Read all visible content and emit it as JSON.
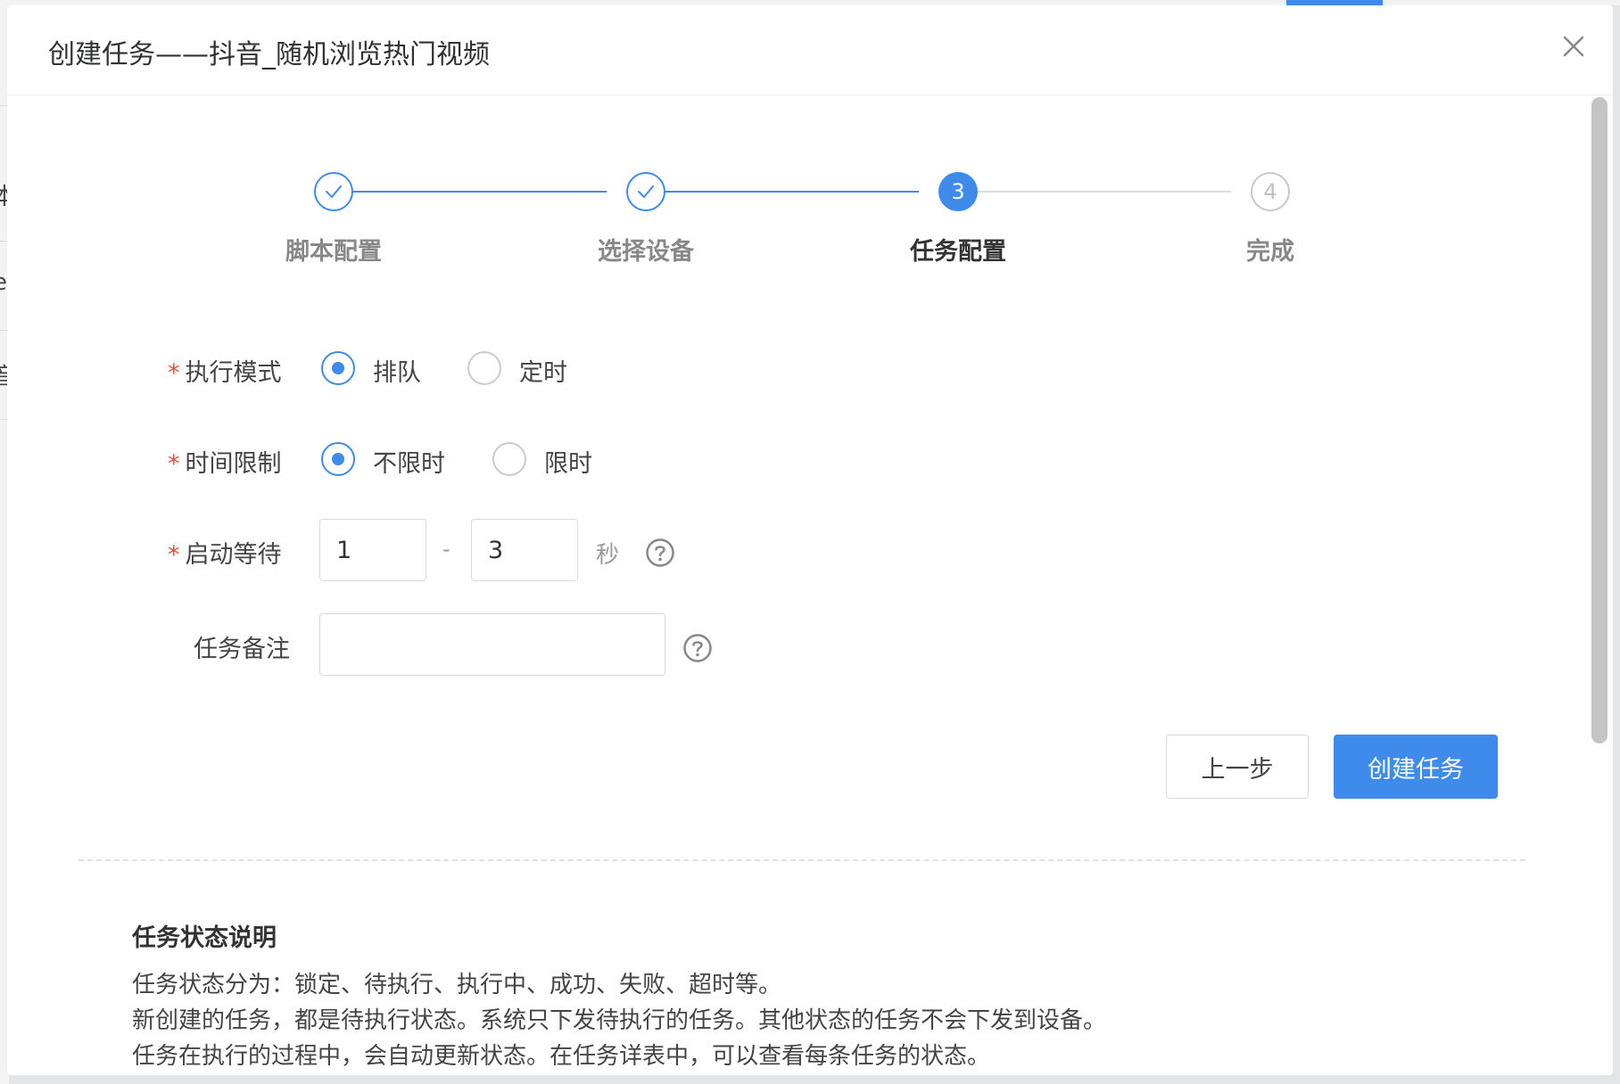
{
  "dialog": {
    "title": "创建任务——抖音_随机浏览热门视频"
  },
  "background": {
    "fragments": [
      "本",
      "e",
      "音"
    ]
  },
  "steps": [
    {
      "index": "1",
      "label": "脚本配置",
      "status": "done"
    },
    {
      "index": "2",
      "label": "选择设备",
      "status": "done"
    },
    {
      "index": "3",
      "label": "任务配置",
      "status": "active"
    },
    {
      "index": "4",
      "label": "完成",
      "status": "wait"
    }
  ],
  "form": {
    "exec_mode": {
      "label": "执行模式",
      "options": [
        "排队",
        "定时"
      ],
      "selected": "排队"
    },
    "time_limit": {
      "label": "时间限制",
      "options": [
        "不限时",
        "限时"
      ],
      "selected": "不限时"
    },
    "start_wait": {
      "label": "启动等待",
      "min": "1",
      "max": "3",
      "separator": "-",
      "unit": "秒"
    },
    "remark": {
      "label": "任务备注",
      "value": "",
      "placeholder": ""
    },
    "required_mark": "*"
  },
  "buttons": {
    "prev": "上一步",
    "create": "创建任务"
  },
  "note": {
    "title": "任务状态说明",
    "lines": [
      "任务状态分为：锁定、待执行、执行中、成功、失败、超时等。",
      "新创建的任务，都是待执行状态。系统只下发待执行的任务。其他状态的任务不会下发到设备。",
      "任务在执行的过程中，会自动更新状态。在任务详表中，可以查看每条任务的状态。"
    ]
  },
  "colors": {
    "primary": "#3e8bec",
    "required": "#f04b3a"
  }
}
